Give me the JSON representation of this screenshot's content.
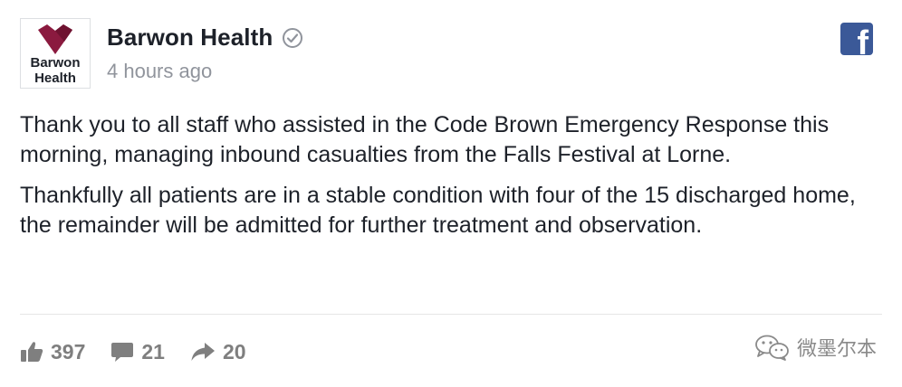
{
  "post": {
    "page_name": "Barwon Health",
    "avatar_text": [
      "Barwon",
      "Health"
    ],
    "timestamp": "4 hours ago",
    "paragraphs": [
      "Thank you to all staff who assisted in the Code Brown Emergency Response this morning, managing inbound casualties from the Falls Festival at Lorne.",
      "Thankfully all patients are in a stable condition with four of the 15 discharged home, the remainder will be admitted for further treatment and observation."
    ],
    "reactions": {
      "likes": "397",
      "comments": "21",
      "shares": "20"
    },
    "watermark": "微墨尔本"
  },
  "colors": {
    "brand_maroon": "#8b1a3f",
    "facebook_blue": "#3b5998",
    "muted_text": "#90949c",
    "action_gray": "#7f7f7f"
  },
  "icons": {
    "verified": "check-circle",
    "facebook": "facebook-f",
    "like": "thumbs-up",
    "comment": "speech-bubble",
    "share": "share-arrow",
    "wechat": "wechat-logo"
  }
}
